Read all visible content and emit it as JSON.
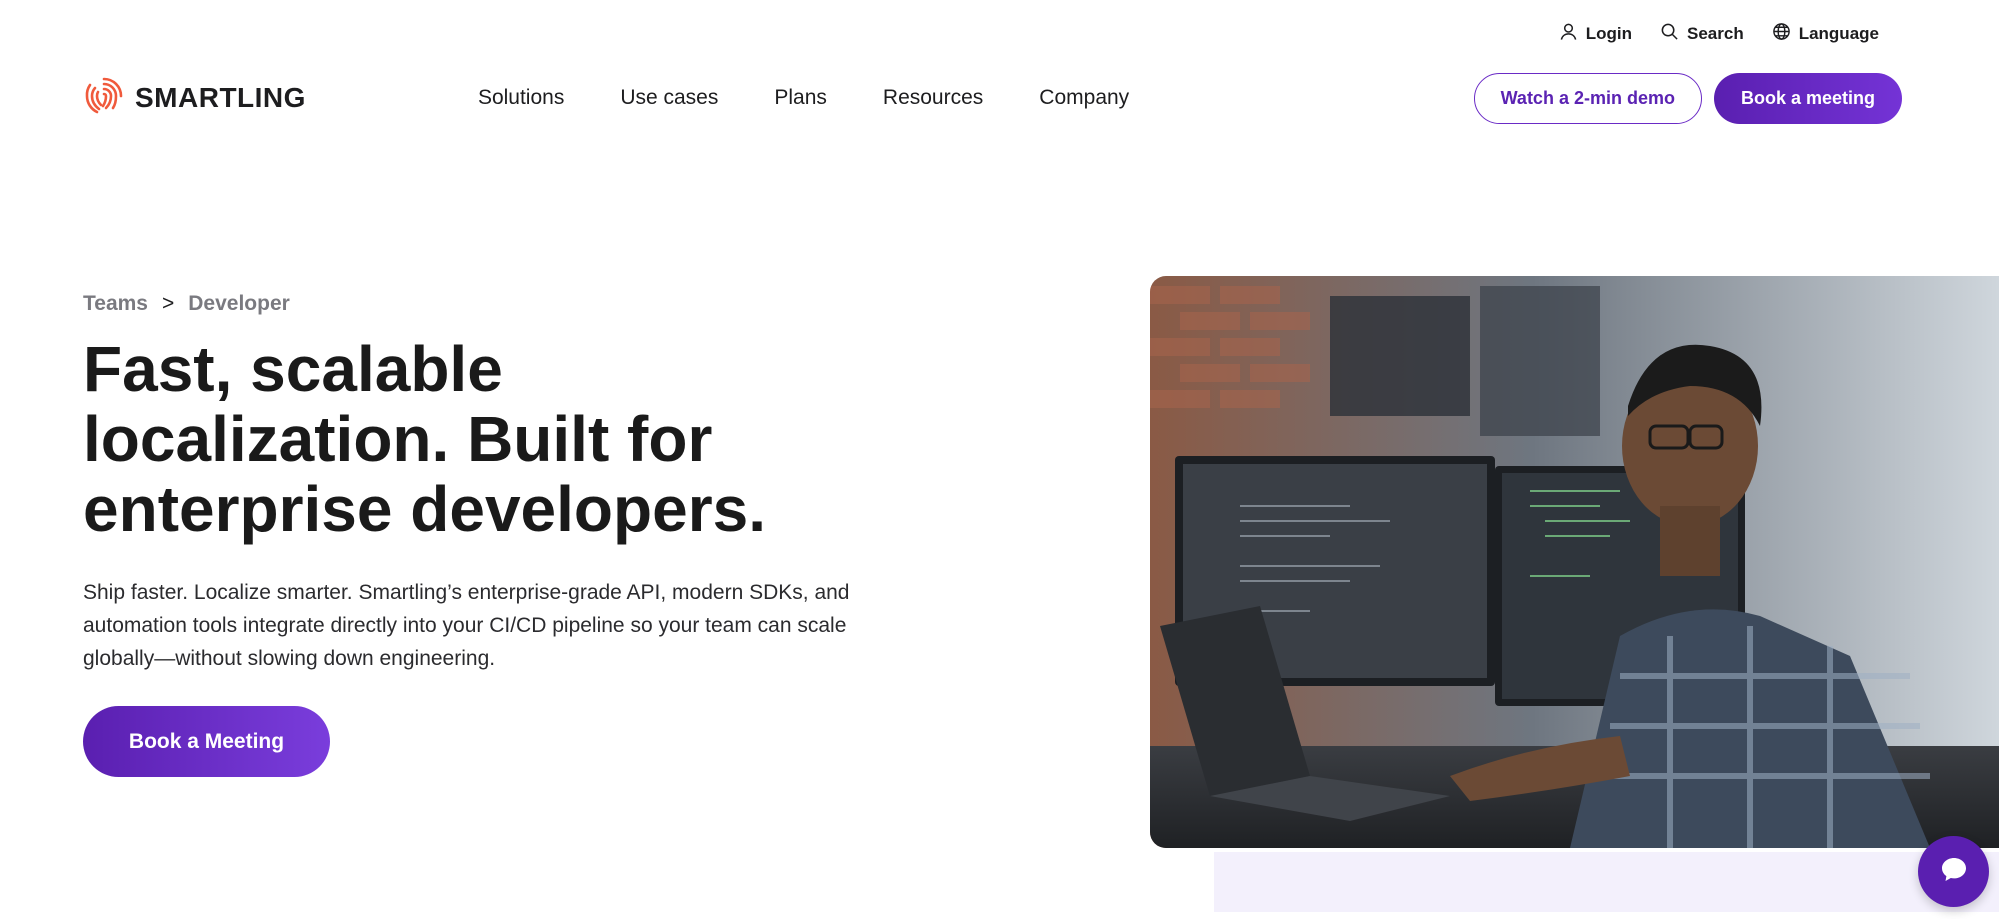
{
  "utility": {
    "login": "Login",
    "search": "Search",
    "language": "Language"
  },
  "logo": {
    "text": "SMARTLING"
  },
  "nav": {
    "items": [
      "Solutions",
      "Use cases",
      "Plans",
      "Resources",
      "Company"
    ],
    "demo_cta": "Watch a 2-min demo",
    "meeting_cta": "Book a meeting"
  },
  "breadcrumb": {
    "parent": "Teams",
    "separator": ">",
    "current": "Developer"
  },
  "hero": {
    "title": "Fast, scalable localization. Built for enterprise developers.",
    "description": "Ship faster. Localize smarter. Smartling’s enterprise-grade API, modern SDKs, and automation tools integrate directly into your CI/CD pipeline so your team can scale globally—without slowing down engineering.",
    "cta": "Book a Meeting"
  },
  "icons": {
    "login": "user-icon",
    "search": "search-icon",
    "language": "globe-icon",
    "chat": "chat-icon"
  },
  "colors": {
    "brand_purple": "#5a1fb0",
    "logo_orange": "#f05a3c",
    "lavender": "#f3f0fc"
  }
}
